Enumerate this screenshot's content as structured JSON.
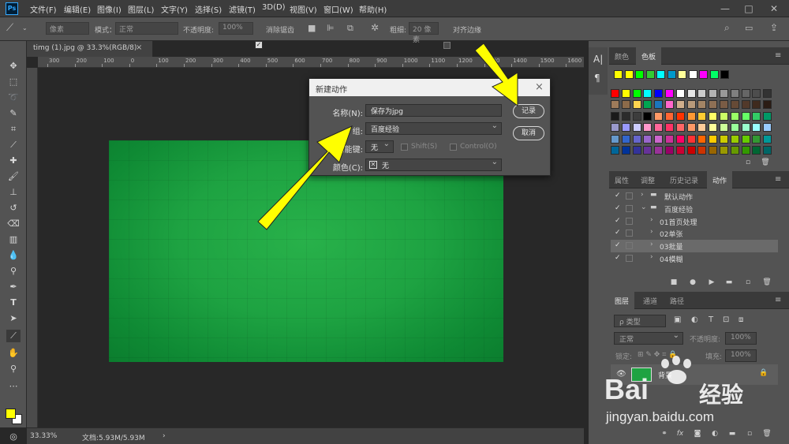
{
  "app": {
    "logo": "Ps"
  },
  "menu": [
    "文件(F)",
    "编辑(E)",
    "图像(I)",
    "图层(L)",
    "文字(Y)",
    "选择(S)",
    "滤镜(T)",
    "3D(D)",
    "视图(V)",
    "窗口(W)",
    "帮助(H)"
  ],
  "window_controls": {
    "minimize": "—",
    "maximize": "□",
    "close": "✕"
  },
  "options": {
    "shape_mode": "像素",
    "mode_label": "模式：",
    "mode_value": "正常",
    "opacity_label": "不透明度:",
    "opacity_value": "100%",
    "antialias_label": "消除锯齿",
    "weight_label": "粗细:",
    "weight_value": "20 像素",
    "align_edges_label": "对齐边缘"
  },
  "document": {
    "tab_title": "timg (1).jpg @ 33.3%(RGB/8)",
    "tab_close": "×",
    "ruler_top": [
      "300",
      "200",
      "100",
      "0",
      "100",
      "200",
      "300",
      "400",
      "500",
      "600",
      "700",
      "800",
      "900",
      "1000",
      "1100",
      "1200",
      "1300",
      "1400",
      "1500",
      "1600",
      "1700",
      "1800",
      "1900",
      "2000"
    ],
    "zoom": "33.33%",
    "doc_info": "文档:5.93M/5.93M",
    "status_arrow": "›"
  },
  "dialog": {
    "title": "新建动作",
    "close": "×",
    "name_label": "名称(N):",
    "name_value": "保存为jpg",
    "group_label": "组:",
    "group_value": "百度经验",
    "fkey_label": "功能键:",
    "fkey_value": "无",
    "shift_label": "Shift(S)",
    "control_label": "Control(O)",
    "color_label": "颜色(C):",
    "color_value": "无",
    "record_button": "记录",
    "cancel_button": "取消"
  },
  "panels": {
    "swatch_tabs": [
      "颜色",
      "色板"
    ],
    "history_tabs": [
      "属性",
      "调整",
      "历史记录",
      "动作"
    ],
    "actions": [
      {
        "label": "默认动作",
        "type": "set"
      },
      {
        "label": "百度经验",
        "type": "set"
      },
      {
        "label": "01首页处理",
        "type": "action"
      },
      {
        "label": "02单张",
        "type": "action"
      },
      {
        "label": "03批量",
        "type": "action",
        "selected": true
      },
      {
        "label": "04模糊",
        "type": "action"
      }
    ],
    "layer_tabs": [
      "图层",
      "通道",
      "路径"
    ],
    "layers": {
      "filter_label": "ρ 类型",
      "blend_mode": "正常",
      "opacity_label": "不透明度:",
      "opacity_value": "100%",
      "lock_label": "锁定:",
      "fill_label": "填充:",
      "fill_value": "100%",
      "layer_name": "背景"
    }
  },
  "watermark": {
    "brand": "Bai",
    "brand2": "经验",
    "url": "jingyan.baidu.com"
  },
  "swatch_colors": {
    "row1": [
      "#ffff00",
      "#ffff00",
      "#00ff00",
      "#33cc33",
      "#00ffff",
      "#0099cc",
      "#ffff99",
      "#ffffff",
      "#ff00ff",
      "#00ff66",
      "#000000"
    ],
    "grid": [
      [
        "#ff0000",
        "#ffff00",
        "#00ff00",
        "#00ffff",
        "#0000ff",
        "#ff00ff",
        "#ffffff",
        "#e6e6e6",
        "#cccccc",
        "#b3b3b3",
        "#999999",
        "#808080",
        "#666666",
        "#4d4d4d",
        "#333333"
      ],
      [
        "#9e7b5a",
        "#8c6b4a",
        "#ffd54f",
        "#00a651",
        "#1b75bc",
        "#ff66cc",
        "#cfae8c",
        "#b89a7a",
        "#a38565",
        "#8e7055",
        "#7a5c45",
        "#664a36",
        "#52392a",
        "#3f2a1e",
        "#2b1c14"
      ],
      [
        "#1a1a1a",
        "#2b2b2b",
        "#3d3d3d",
        "#000000",
        "#ff9966",
        "#ff6633",
        "#ff3300",
        "#ff9933",
        "#ffcc33",
        "#ffff66",
        "#ccff66",
        "#99ff66",
        "#66ff66",
        "#33cc66",
        "#009966"
      ],
      [
        "#9999cc",
        "#9999ff",
        "#ccccff",
        "#ff99cc",
        "#ff6699",
        "#ff3366",
        "#ff6666",
        "#ff9966",
        "#ffcc99",
        "#ffff99",
        "#ccff99",
        "#99ff99",
        "#99ffcc",
        "#99ffff",
        "#99ccff"
      ],
      [
        "#6699cc",
        "#3366cc",
        "#6666cc",
        "#9966cc",
        "#cc66cc",
        "#cc3399",
        "#ff0066",
        "#ff3333",
        "#ff6600",
        "#ffcc00",
        "#cccc00",
        "#99cc00",
        "#66cc00",
        "#339933",
        "#009999"
      ],
      [
        "#006699",
        "#003399",
        "#333399",
        "#663399",
        "#993399",
        "#990066",
        "#cc0033",
        "#cc0000",
        "#cc3300",
        "#996600",
        "#999900",
        "#669900",
        "#339900",
        "#006633",
        "#006666"
      ]
    ]
  },
  "accent_colors": {
    "annotation_arrow": "#ffff00",
    "fg_color": "#ffff00",
    "bg_color": "#ffffff",
    "canvas_green": "#1ea342"
  }
}
